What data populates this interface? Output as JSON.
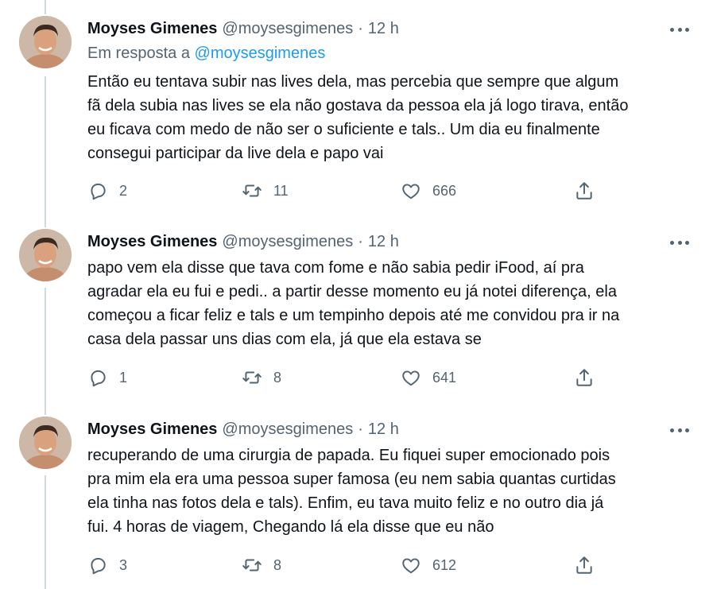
{
  "tweets": [
    {
      "author": "Moyses Gimenes",
      "handle": "@moysesgimenes",
      "separator": "·",
      "time": "12 h",
      "reply_prefix": "Em resposta a",
      "reply_mention": "@moysesgimenes",
      "lines": [
        "Então eu tentava subir nas lives dela, mas percebia que sempre que algum",
        "fã dela subia nas lives se ela não gostava da pessoa ela já logo tirava, então",
        "eu ficava com medo de não ser o suficiente e tals.. Um dia eu finalmente",
        "consegui participar da live dela e papo vai"
      ],
      "replies": "2",
      "retweets": "11",
      "likes": "666"
    },
    {
      "author": "Moyses Gimenes",
      "handle": "@moysesgimenes",
      "separator": "·",
      "time": "12 h",
      "lines": [
        "papo vem ela disse que tava com fome e não sabia pedir iFood, aí pra",
        "agradar ela eu fui e pedi.. a partir desse momento eu já notei diferença, ela",
        "começou a ficar feliz e tals e um tempinho depois até me convidou pra ir na",
        "casa dela passar uns dias com ela, já que ela estava se"
      ],
      "replies": "1",
      "retweets": "8",
      "likes": "641"
    },
    {
      "author": "Moyses Gimenes",
      "handle": "@moysesgimenes",
      "separator": "·",
      "time": "12 h",
      "lines": [
        "recuperando de uma cirurgia de papada. Eu fiquei super emocionado pois",
        "pra mim ela era uma pessoa super famosa (eu nem sabia quantas curtidas",
        "ela tinha nas fotos dela e tals). Enfim, eu tava muito feliz e no outro dia já",
        "fui. 4 horas de viagem, Chegando lá ela disse que eu não"
      ],
      "replies": "3",
      "retweets": "8",
      "likes": "612"
    }
  ],
  "icons": {
    "reply": "reply-icon",
    "retweet": "retweet-icon",
    "like": "heart-icon",
    "share": "share-icon",
    "more": "more-icon"
  },
  "colors": {
    "text": "#0f1419",
    "muted": "#536471",
    "link": "#1d9bf0",
    "thread_line": "#cfd9de"
  }
}
